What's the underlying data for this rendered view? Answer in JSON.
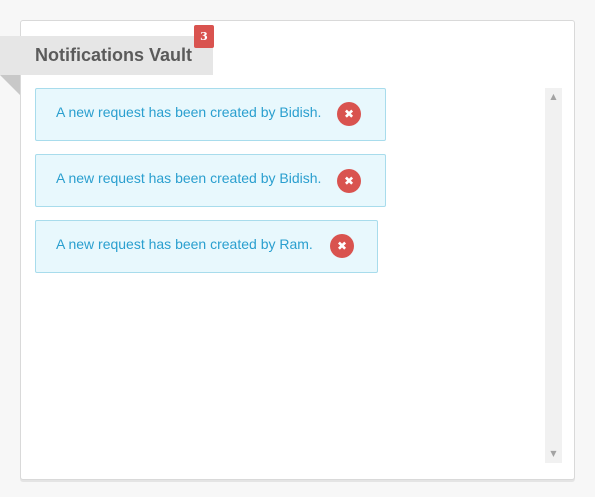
{
  "header": {
    "title": "Notifications Vault",
    "count": "3"
  },
  "notifications": [
    {
      "text": "A new request has been created by Bidish.",
      "dismiss_icon": "✖"
    },
    {
      "text": "A new request has been created by Bidish.",
      "dismiss_icon": "✖"
    },
    {
      "text": "A new request has been created by Ram.",
      "dismiss_icon": "✖"
    }
  ],
  "scrollbar": {
    "up_icon": "▲",
    "down_icon": "▼"
  },
  "colors": {
    "badge": "#d9534f",
    "notification_bg": "#e8f8fd",
    "notification_border": "#a8dcec",
    "notification_text": "#2a9fcf",
    "ribbon": "#e6e6e6"
  }
}
